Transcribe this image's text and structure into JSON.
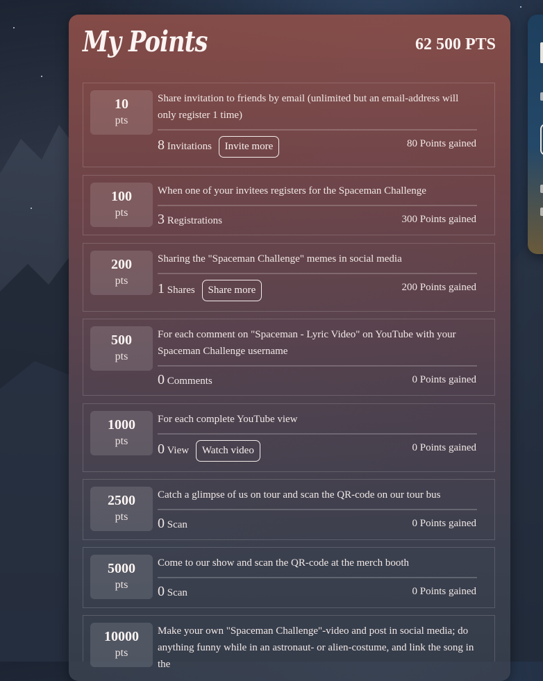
{
  "header": {
    "title": "My Points",
    "total": "62 500 PTS"
  },
  "colors": {
    "panel_top": "#8c4e48",
    "panel_bottom": "#3a4250",
    "side_card": "#1e3f5e"
  },
  "rows": [
    {
      "points": "10",
      "unit": "pts",
      "description": "Share invitation to friends by email (unlimited but an email-address will only register 1 time)",
      "count": "8",
      "count_label": "Invitations",
      "action": "Invite more",
      "gained": "80 Points gained"
    },
    {
      "points": "100",
      "unit": "pts",
      "description": "When one of your invitees registers for the Spaceman Challenge",
      "count": "3",
      "count_label": "Registrations",
      "action": "",
      "gained": "300 Points gained"
    },
    {
      "points": "200",
      "unit": "pts",
      "description": "Sharing the \"Spaceman Challenge\" memes in social media",
      "count": "1",
      "count_label": "Shares",
      "action": "Share more",
      "gained": "200 Points gained"
    },
    {
      "points": "500",
      "unit": "pts",
      "description": "For each comment on \"Spaceman - Lyric Video\" on YouTube with your Spaceman Challenge username",
      "count": "0",
      "count_label": "Comments",
      "action": "",
      "gained": "0 Points gained"
    },
    {
      "points": "1000",
      "unit": "pts",
      "description": "For each complete YouTube view",
      "count": "0",
      "count_label": "View",
      "action": "Watch video",
      "gained": "0 Points gained"
    },
    {
      "points": "2500",
      "unit": "pts",
      "description": "Catch a glimpse of us on tour and scan the QR-code on our tour bus",
      "count": "0",
      "count_label": "Scan",
      "action": "",
      "gained": "0 Points gained"
    },
    {
      "points": "5000",
      "unit": "pts",
      "description": "Come to our show and scan the QR-code at the merch booth",
      "count": "0",
      "count_label": "Scan",
      "action": "",
      "gained": "0 Points gained"
    },
    {
      "points": "10000",
      "unit": "pts",
      "description": "Make your own \"Spaceman Challenge\"-video and post in social media; do anything funny while in an astronaut- or alien-costume, and link the song in the",
      "count": "",
      "count_label": "",
      "action": "",
      "gained": ""
    }
  ]
}
